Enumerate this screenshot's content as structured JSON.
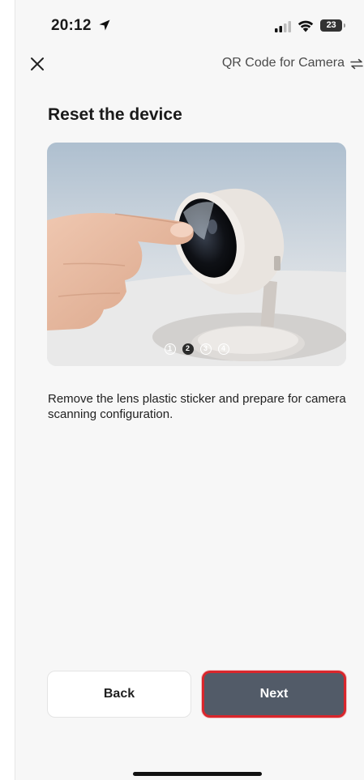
{
  "status_bar": {
    "time": "20:12",
    "battery": "23",
    "icons": [
      "location-arrow-icon",
      "cellular-signal-icon",
      "wifi-icon",
      "battery-icon"
    ]
  },
  "nav": {
    "close_icon": "close-icon",
    "title": "QR Code for Camera",
    "switch_icon": "swap-icon"
  },
  "page": {
    "title": "Reset the device",
    "description": "Remove the lens plastic sticker and prepare for camera scanning configuration."
  },
  "carousel": {
    "image": "hand-removing-camera-lens-sticker",
    "steps": [
      "1",
      "2",
      "3",
      "4"
    ],
    "active_step": 2
  },
  "buttons": {
    "back": "Back",
    "next": "Next"
  },
  "colors": {
    "next_button": "#525b68",
    "highlight_border": "#d9262c",
    "background": "#f7f7f7"
  }
}
